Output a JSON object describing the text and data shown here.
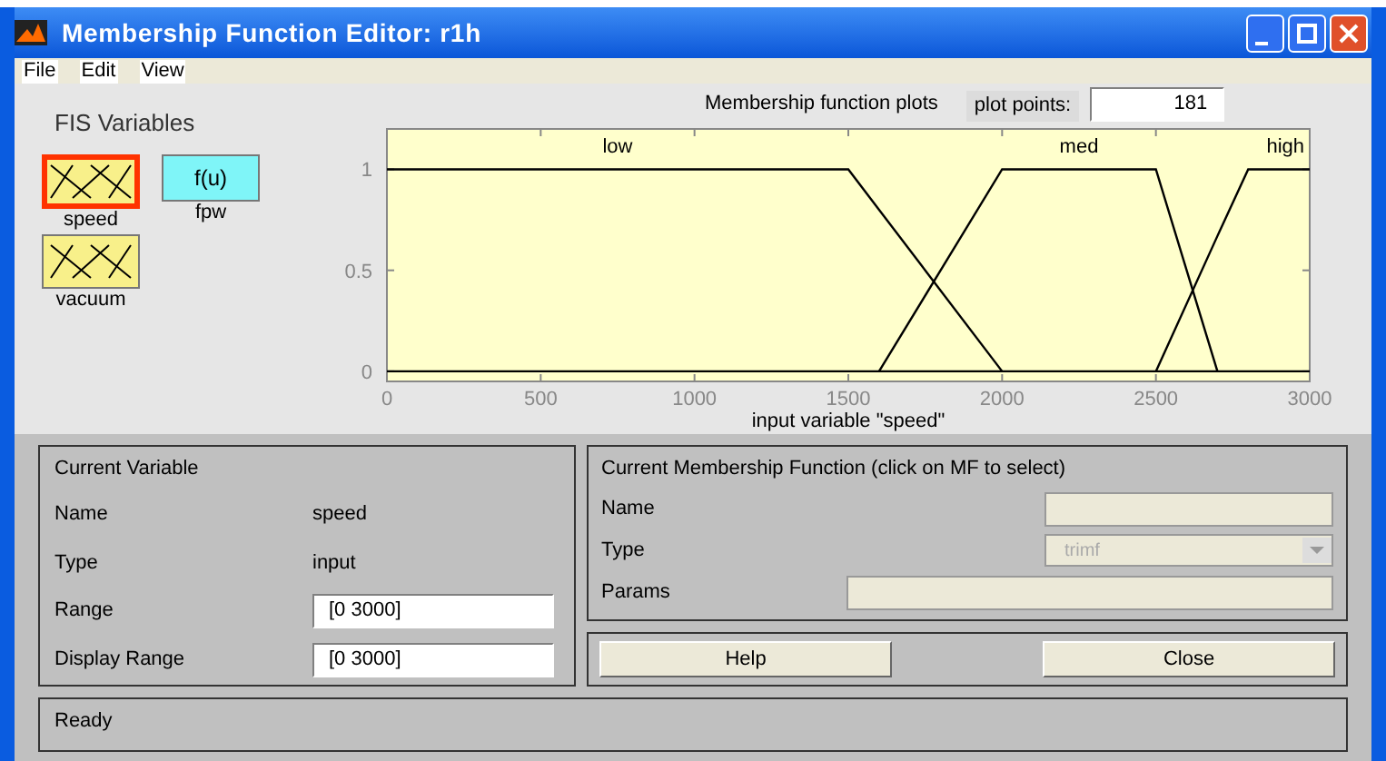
{
  "window": {
    "title": "Membership Function Editor: r1h"
  },
  "menu": [
    "File",
    "Edit",
    "View"
  ],
  "fis_variables": {
    "title": "FIS Variables",
    "items": [
      {
        "label": "speed",
        "kind": "input",
        "selected": true
      },
      {
        "label": "fpw",
        "kind": "system",
        "icon_text": "f(u)",
        "selected": false
      },
      {
        "label": "vacuum",
        "kind": "input",
        "selected": false
      }
    ]
  },
  "plot": {
    "title": "Membership function plots",
    "plot_points_label": "plot points:",
    "plot_points": "181",
    "chart_data": {
      "type": "line",
      "xlabel": "input variable \"speed\"",
      "x": [
        0,
        1500,
        1600,
        2000,
        2500,
        2700,
        2800,
        3000
      ],
      "series": [
        {
          "name": "low",
          "color": "#000000",
          "values": [
            1,
            1,
            0.8,
            0,
            null,
            null,
            null,
            null
          ]
        },
        {
          "name": "med",
          "color": "#000000",
          "values": [
            null,
            null,
            0,
            1,
            1,
            0,
            null,
            null
          ]
        },
        {
          "name": "high",
          "color": "#000000",
          "values": [
            null,
            null,
            null,
            null,
            0,
            0.67,
            1,
            1
          ]
        }
      ],
      "xlim": [
        0,
        3000
      ],
      "ylim": [
        -0.05,
        1.2
      ],
      "xticks": [
        0,
        500,
        1000,
        1500,
        2000,
        2500,
        3000
      ],
      "yticks": [
        0,
        0.5,
        1
      ]
    }
  },
  "current_variable": {
    "title": "Current Variable",
    "rows": [
      {
        "label": "Name",
        "kind": "text",
        "value": "speed"
      },
      {
        "label": "Type",
        "kind": "text",
        "value": "input"
      },
      {
        "label": "Range",
        "kind": "field",
        "value": "[0 3000]"
      },
      {
        "label": "Display Range",
        "kind": "field",
        "value": "[0 3000]"
      }
    ]
  },
  "current_mf": {
    "title": "Current Membership Function (click on MF to select)",
    "name_label": "Name",
    "type_label": "Type",
    "type_value": "trimf",
    "params_label": "Params",
    "disabled": true
  },
  "buttons": [
    "Help",
    "Close"
  ],
  "status_bar": "Ready"
}
